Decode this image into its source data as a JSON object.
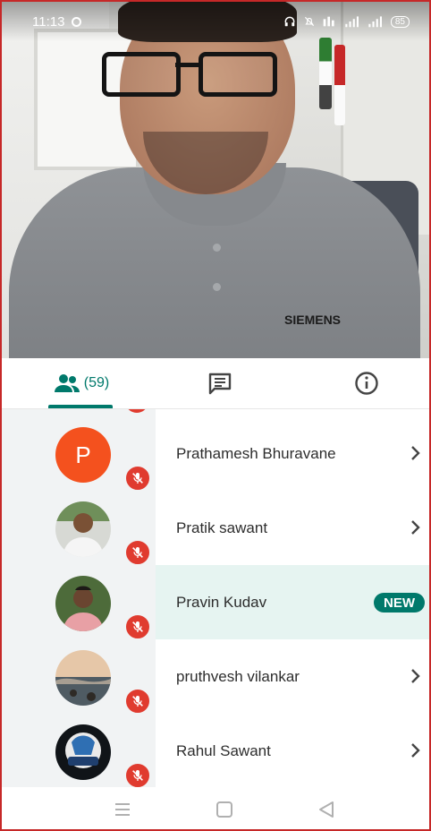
{
  "status_bar": {
    "time": "11:13",
    "battery": "85"
  },
  "video": {
    "shirt_logo": "SIEMENS"
  },
  "tabs": {
    "people_count": "(59)"
  },
  "participants": [
    {
      "name": "Prathamesh Bhuravane",
      "avatar_letter": "P",
      "muted": true,
      "badge": ""
    },
    {
      "name": "Pratik sawant",
      "avatar_letter": "",
      "muted": true,
      "badge": ""
    },
    {
      "name": "Pravin Kudav",
      "avatar_letter": "",
      "muted": true,
      "badge": "NEW"
    },
    {
      "name": "pruthvesh vilankar",
      "avatar_letter": "",
      "muted": true,
      "badge": ""
    },
    {
      "name": "Rahul Sawant",
      "avatar_letter": "",
      "muted": true,
      "badge": ""
    }
  ],
  "colors": {
    "accent": "#00796b",
    "mic_muted": "#e03b2f",
    "highlight_row": "#e6f4f1",
    "avatar_orange": "#f4511e"
  },
  "icons": [
    "people-icon",
    "chat-icon",
    "info-icon",
    "mic-off-icon",
    "chevron-right-icon",
    "menu-icon",
    "home-icon",
    "back-icon"
  ]
}
